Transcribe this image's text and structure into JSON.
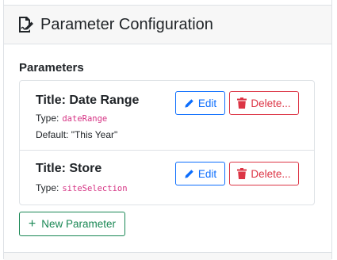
{
  "header": {
    "title": "Parameter Configuration",
    "icon": "file-signature-icon"
  },
  "section": {
    "title": "Parameters"
  },
  "parameters": [
    {
      "title": "Title: Date Range",
      "type_label": "Type:",
      "type_value": "dateRange",
      "default_text": "Default: \"This Year\""
    },
    {
      "title": "Title: Store",
      "type_label": "Type:",
      "type_value": "siteSelection"
    }
  ],
  "buttons": {
    "edit": "Edit",
    "delete": "Delete...",
    "new_parameter": "New Parameter"
  },
  "colors": {
    "primary": "#0d6efd",
    "danger": "#dc3545",
    "success": "#198754",
    "code": "#d63384"
  }
}
